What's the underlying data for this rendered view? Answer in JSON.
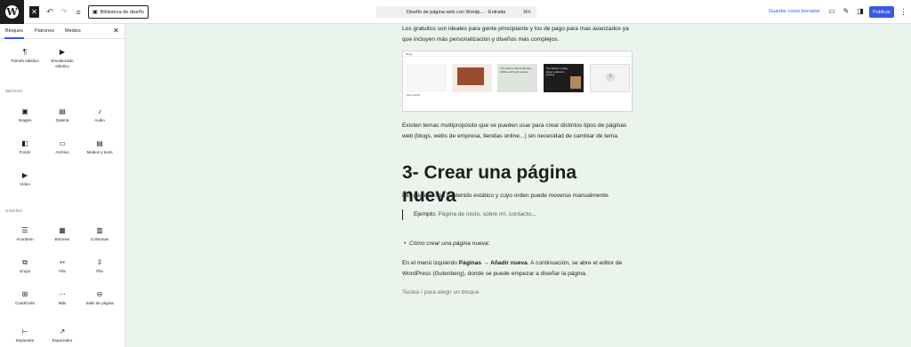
{
  "toolbar": {
    "logo": "W",
    "close_label": "✕",
    "undo_icon": "↶",
    "redo_icon": "↷",
    "list_icon": "≡",
    "design_library_label": "Biblioteca de diseño",
    "document_title": "Diseño de página web con Wordp... · Entrada",
    "shortcut": "⌘K",
    "save_draft_label": "Guardar como borrador",
    "publish_label": "Publicar",
    "more_icon": "⋮"
  },
  "sidebar": {
    "tabs": [
      "Bloques",
      "Patrones",
      "Medios"
    ],
    "close_label": "✕",
    "top_blocks": [
      {
        "label": "Párrafo elástico",
        "icon": "¶"
      },
      {
        "label": "Encabezado elástico",
        "icon": "▶"
      }
    ],
    "sections": [
      {
        "title": "MEDIOS",
        "blocks": [
          {
            "label": "Imagen",
            "icon": "▣"
          },
          {
            "label": "Galería",
            "icon": "▤"
          },
          {
            "label": "Audio",
            "icon": "♪"
          },
          {
            "label": "Fondo",
            "icon": "◧"
          },
          {
            "label": "Archivo",
            "icon": "▭"
          },
          {
            "label": "Medios y texto",
            "icon": "▤"
          },
          {
            "label": "Vídeo",
            "icon": "▶"
          }
        ]
      },
      {
        "title": "DISEÑO",
        "blocks": [
          {
            "label": "Acordeón",
            "icon": "☰"
          },
          {
            "label": "Botones",
            "icon": "▦"
          },
          {
            "label": "Columnas",
            "icon": "▥"
          },
          {
            "label": "Grupo",
            "icon": "⧉"
          },
          {
            "label": "Fila",
            "icon": "⇿"
          },
          {
            "label": "Pila",
            "icon": "⇳"
          },
          {
            "label": "Cuadrícula",
            "icon": "⊞"
          },
          {
            "label": "Más",
            "icon": "⋯"
          },
          {
            "label": "Salto de página",
            "icon": "⊖"
          },
          {
            "label": "Separador",
            "icon": "⊢"
          },
          {
            "label": "Espaciador",
            "icon": "↗"
          }
        ]
      }
    ]
  },
  "editor": {
    "para1": "Los gratuitos son ideales para gente principiante y los de pago para mas avanzados ya que incluyen más personalización y diseños más complejos.",
    "screenshot": {
      "bar_text": "Tema",
      "cards": [
        {
          "bg": "#f6f6f6",
          "caption": "Hello World!"
        },
        {
          "bg": "#f2ece4",
          "caption": ""
        },
        {
          "bg": "#dfe4df",
          "caption": "The works of Berthe Morisot, 1800s-era French painter"
        },
        {
          "bg": "#1d1d1d",
          "caption": "The Dancer: a blog about a dancer's journey"
        },
        {
          "bg": "#f3f3f3",
          "caption": "+"
        }
      ]
    },
    "para2": "Existen temas multipropósito que se pueden usar para crear distintos tipos de páginas web (blogs, webs de empresa, tiendas online...) sin necesidad de cambiar de tema.",
    "heading": "3- Crear una página nueva",
    "para3": "Las páginas son contenido estático y cuyo orden puede moverse manualmente.",
    "quote_prefix": "Ejemplo: ",
    "quote_link": "Página de inicio, sobre mí, contacto",
    "quote_suffix": "...",
    "bullet": "Cómo crear una página nueva",
    "bullet_suffix": ":",
    "para4_a": "En el menú izquierdo ",
    "para4_bold": "Páginas → Añadir nueva",
    "para4_b": ". A continuación, se abre el editor de WordPress (Gutenberg), donde se puede empezar a diseñar la página.",
    "placeholder": "Teclea / para elegir un bloque"
  }
}
